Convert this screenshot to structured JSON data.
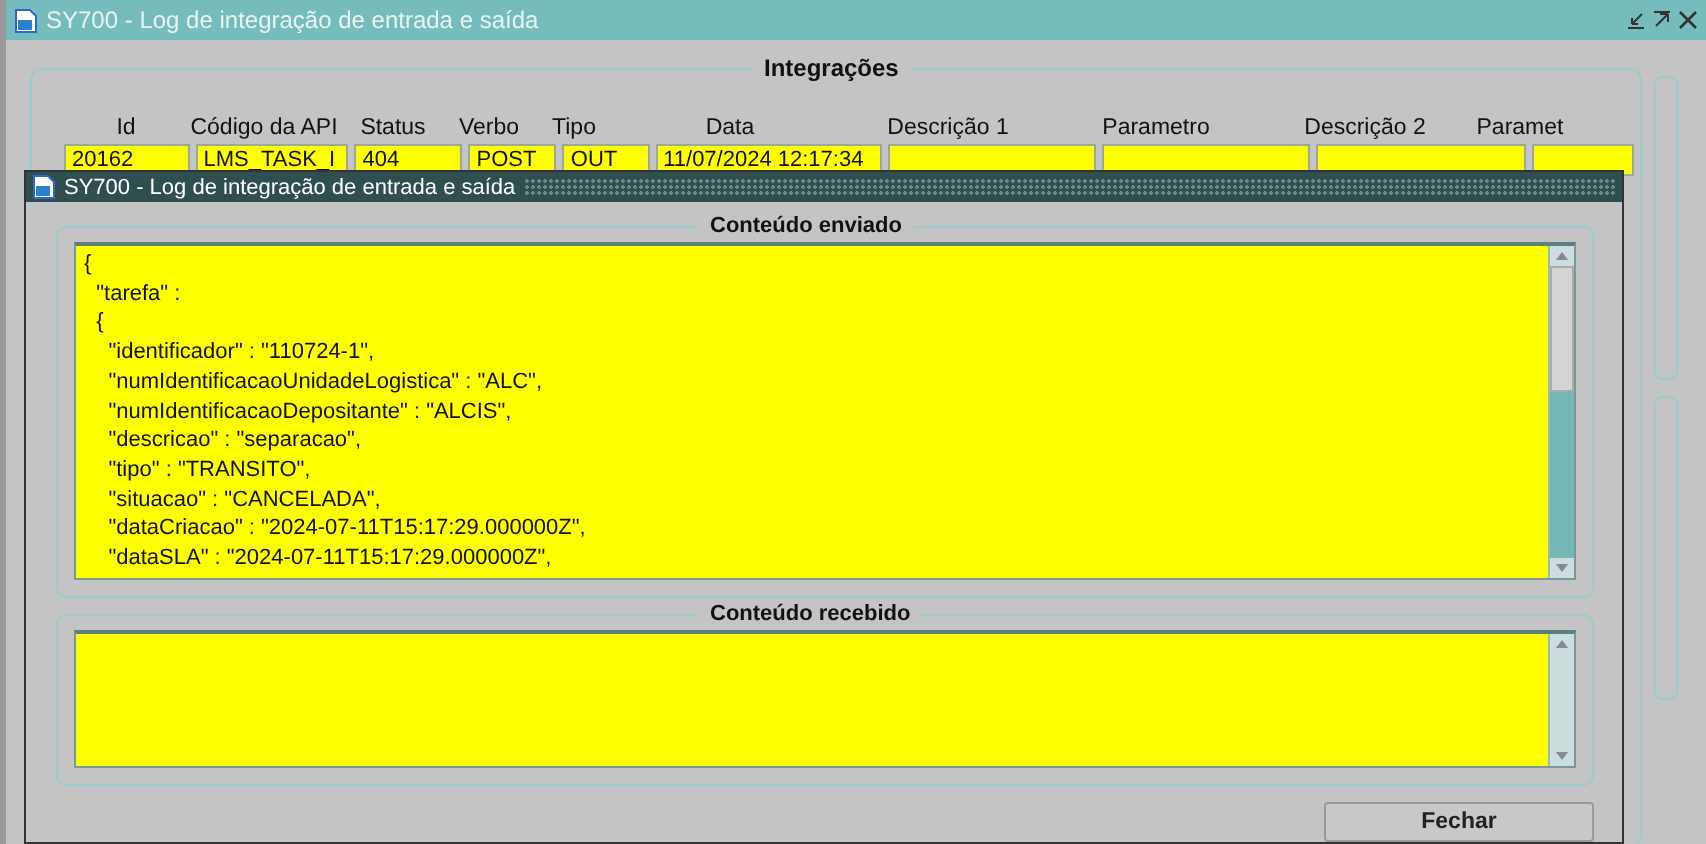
{
  "window": {
    "title": "SY700 - Log de integração de entrada e saída"
  },
  "integracoes": {
    "title": "Integrações",
    "columns": [
      "Id",
      "Código da API",
      "Status",
      "Verbo",
      "Tipo",
      "Data",
      "Descrição 1",
      "Parametro",
      "Descrição 2",
      "Paramet"
    ],
    "rows": [
      {
        "cells": [
          "20162",
          "LMS_TASK_I",
          "404",
          "POST",
          "OUT",
          "11/07/2024 12:17:34",
          "",
          "",
          "",
          ""
        ]
      }
    ]
  },
  "dialog": {
    "title": "SY700 - Log de integração de entrada e saída",
    "sent": {
      "title": "Conteúdo enviado",
      "lines": [
        "{",
        "  \"tarefa\" :",
        "  {",
        "    \"identificador\" : \"110724-1\",",
        "    \"numIdentificacaoUnidadeLogistica\" : \"ALC\",",
        "    \"numIdentificacaoDepositante\" : \"ALCIS\",",
        "    \"descricao\" : \"separacao\",",
        "    \"tipo\" : \"TRANSITO\",",
        "    \"situacao\" : \"CANCELADA\",",
        "    \"dataCriacao\" : \"2024-07-11T15:17:29.000000Z\",",
        "    \"dataSLA\" : \"2024-07-11T15:17:29.000000Z\","
      ]
    },
    "received": {
      "title": "Conteúdo recebido"
    },
    "button": "Fechar"
  }
}
